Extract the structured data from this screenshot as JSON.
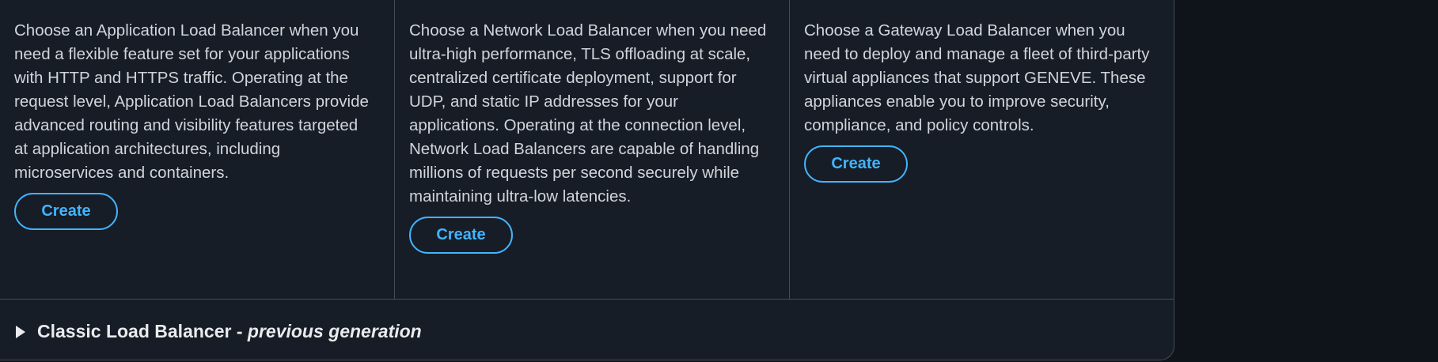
{
  "load_balancer_types": [
    {
      "description": "Choose an Application Load Balancer when you need a flexible feature set for your applications with HTTP and HTTPS traffic. Operating at the request level, Application Load Balancers provide advanced routing and visibility features targeted at application architectures, including microservices and containers.",
      "button_label": "Create"
    },
    {
      "description": "Choose a Network Load Balancer when you need ultra-high performance, TLS offloading at scale, centralized certificate deployment, support for UDP, and static IP addresses for your applications. Operating at the connection level, Network Load Balancers are capable of handling millions of requests per second securely while maintaining ultra-low latencies.",
      "button_label": "Create"
    },
    {
      "description": "Choose a Gateway Load Balancer when you need to deploy and manage a fleet of third-party virtual appliances that support GENEVE. These appliances enable you to improve security, compliance, and policy controls.",
      "button_label": "Create"
    }
  ],
  "classic_section": {
    "title": "Classic Load Balancer",
    "separator": " - ",
    "subtitle": "previous generation",
    "expanded": false,
    "icon": "caret-right-icon"
  },
  "colors": {
    "background": "#0f141a",
    "panel": "#161d26",
    "border": "#414d5c",
    "text": "#d1d5db",
    "link_accent": "#42b4ff"
  }
}
